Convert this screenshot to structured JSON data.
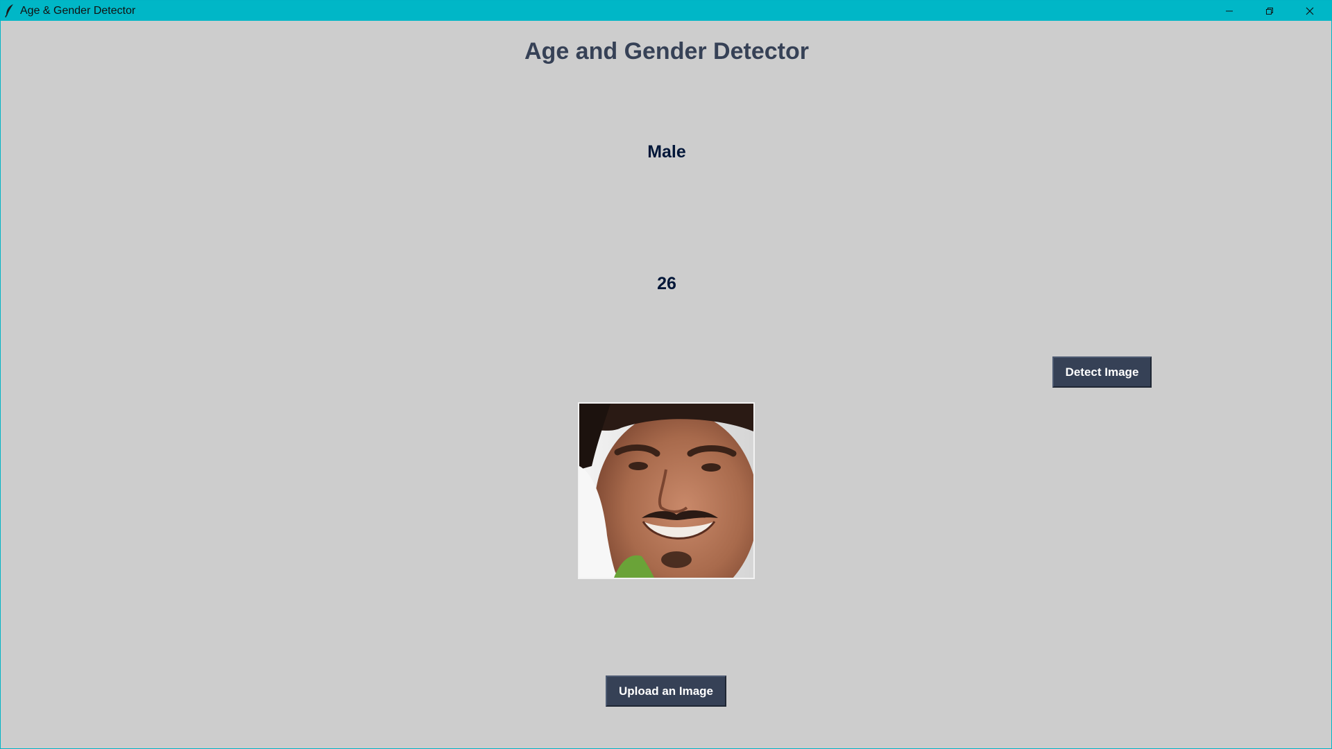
{
  "window": {
    "title": "Age & Gender Detector",
    "app_icon": "feather-icon",
    "controls": [
      "minimize-icon",
      "restore-icon",
      "close-icon"
    ],
    "titlebar_color": "#00b7c7"
  },
  "main": {
    "heading": "Age and Gender Detector",
    "gender_result": "Male",
    "age_result": "26",
    "heading_color": "#364156",
    "result_color": "#011638",
    "background_color": "#cdcdcd"
  },
  "buttons": {
    "detect_label": "Detect Image",
    "upload_label": "Upload an Image",
    "color": "#364156"
  },
  "preview": {
    "icon": "uploaded-face-photo"
  }
}
